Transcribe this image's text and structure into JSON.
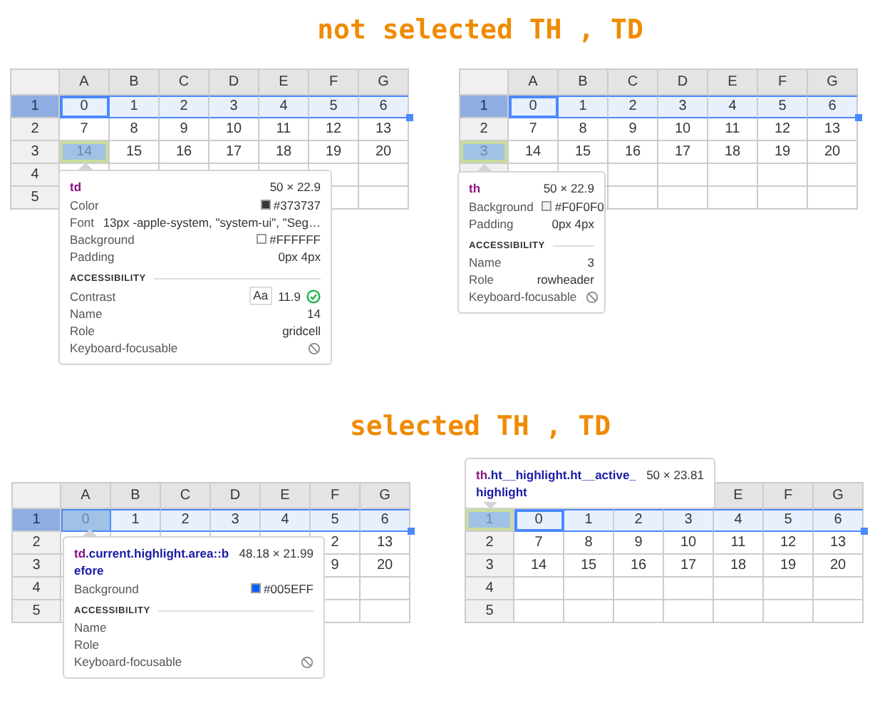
{
  "sections": [
    {
      "heading": "not selected TH , TD",
      "panels": [
        {
          "grid": {
            "columns": [
              "A",
              "B",
              "C",
              "D",
              "E",
              "F",
              "G"
            ],
            "rows": [
              {
                "header": "1",
                "selected": true,
                "cells": [
                  "0",
                  "1",
                  "2",
                  "3",
                  "4",
                  "5",
                  "6"
                ]
              },
              {
                "header": "2",
                "selected": false,
                "cells": [
                  "7",
                  "8",
                  "9",
                  "10",
                  "11",
                  "12",
                  "13"
                ]
              },
              {
                "header": "3",
                "selected": false,
                "cell_inspected": true,
                "cells": [
                  "14",
                  "15",
                  "16",
                  "17",
                  "18",
                  "19",
                  "20"
                ]
              },
              {
                "header": "4",
                "selected": false
              },
              {
                "header": "5",
                "selected": false
              }
            ]
          },
          "tooltip": {
            "tag": "td",
            "dimensions": "50 × 22.9",
            "props": [
              {
                "kind": "swatch",
                "label": "Color",
                "value": "#373737",
                "color": "#373737"
              },
              {
                "kind": "text",
                "label": "Font",
                "value": "13px -apple-system, \"system-ui\", \"Seg…"
              },
              {
                "kind": "swatch",
                "label": "Background",
                "value": "#FFFFFF",
                "color": "#ffffff"
              },
              {
                "kind": "text",
                "label": "Padding",
                "value": "0px 4px"
              }
            ],
            "section": "ACCESSIBILITY",
            "a11y": [
              {
                "kind": "contrast",
                "label": "Contrast",
                "badge": "Aa",
                "value": "11.9",
                "passed": true
              },
              {
                "kind": "text",
                "label": "Name",
                "value": "14"
              },
              {
                "kind": "text",
                "label": "Role",
                "value": "gridcell"
              },
              {
                "kind": "flag",
                "label": "Keyboard-focusable",
                "focusable": false
              }
            ]
          }
        },
        {
          "grid": {
            "columns": [
              "A",
              "B",
              "C",
              "D",
              "E",
              "F",
              "G"
            ],
            "rows": [
              {
                "header": "1",
                "selected": true,
                "cells": [
                  "0",
                  "1",
                  "2",
                  "3",
                  "4",
                  "5",
                  "6"
                ]
              },
              {
                "header": "2",
                "selected": false,
                "cells": [
                  "7",
                  "8",
                  "9",
                  "10",
                  "11",
                  "12",
                  "13"
                ]
              },
              {
                "header": "3",
                "selected": false,
                "header_inspected": true,
                "cells": [
                  "14",
                  "15",
                  "16",
                  "17",
                  "18",
                  "19",
                  "20"
                ]
              },
              {
                "selected": false
              },
              {
                "selected": false
              }
            ]
          },
          "tooltip": {
            "tag": "th",
            "dimensions": "50 × 22.9",
            "props": [
              {
                "kind": "swatch",
                "label": "Background",
                "value": "#F0F0F0",
                "color": "#f0f0f0"
              },
              {
                "kind": "text",
                "label": "Padding",
                "value": "0px 4px"
              }
            ],
            "section": "ACCESSIBILITY",
            "a11y": [
              {
                "kind": "text",
                "label": "Name",
                "value": "3"
              },
              {
                "kind": "text",
                "label": "Role",
                "value": "rowheader"
              },
              {
                "kind": "flag",
                "label": "Keyboard-focusable",
                "focusable": false
              }
            ]
          }
        }
      ]
    },
    {
      "heading": "selected TH , TD",
      "panels": [
        {
          "grid": {
            "columns": [
              "A",
              "B",
              "C",
              "D",
              "E",
              "F",
              "G"
            ],
            "rows": [
              {
                "header": "1",
                "selected": true,
                "cell_inspected": true,
                "cells": [
                  "0",
                  "1",
                  "2",
                  "3",
                  "4",
                  "5",
                  "6"
                ]
              },
              {
                "header": "2",
                "selected": false,
                "cells": [
                  null,
                  null,
                  null,
                  null,
                  null,
                  "2",
                  "13"
                ]
              },
              {
                "header": "3",
                "selected": false,
                "cells": [
                  null,
                  null,
                  null,
                  null,
                  null,
                  "9",
                  "20"
                ]
              },
              {
                "header": "4",
                "selected": false
              },
              {
                "header": "5",
                "selected": false
              }
            ]
          },
          "tooltip": {
            "tag": "td",
            "classes": ".current.highlight.area::before",
            "dimensions": "48.18 × 21.99",
            "props": [
              {
                "kind": "swatch",
                "label": "Background",
                "value": "#005EFF",
                "color": "#005eff"
              }
            ],
            "section": "ACCESSIBILITY",
            "a11y": [
              {
                "kind": "text",
                "label": "Name"
              },
              {
                "kind": "text",
                "label": "Role"
              },
              {
                "kind": "flag",
                "label": "Keyboard-focusable",
                "focusable": false
              }
            ]
          }
        },
        {
          "grid": {
            "columns": [
              null,
              null,
              null,
              null,
              "E",
              "F",
              "G"
            ],
            "rows": [
              {
                "header": "1",
                "selected": true,
                "header_inspected": true,
                "cells": [
                  "0",
                  "1",
                  "2",
                  "3",
                  "4",
                  "5",
                  "6"
                ]
              },
              {
                "header": "2",
                "selected": false,
                "cells": [
                  "7",
                  "8",
                  "9",
                  "10",
                  "11",
                  "12",
                  "13"
                ]
              },
              {
                "header": "3",
                "selected": false,
                "cells": [
                  "14",
                  "15",
                  "16",
                  "17",
                  "18",
                  "19",
                  "20"
                ]
              },
              {
                "header": "4",
                "selected": false
              },
              {
                "header": "5",
                "selected": false
              }
            ]
          },
          "tooltip": {
            "tag": "th",
            "classes": ".ht__highlight.ht__active_highlight",
            "dimensions": "50 × 23.81"
          }
        }
      ]
    }
  ]
}
